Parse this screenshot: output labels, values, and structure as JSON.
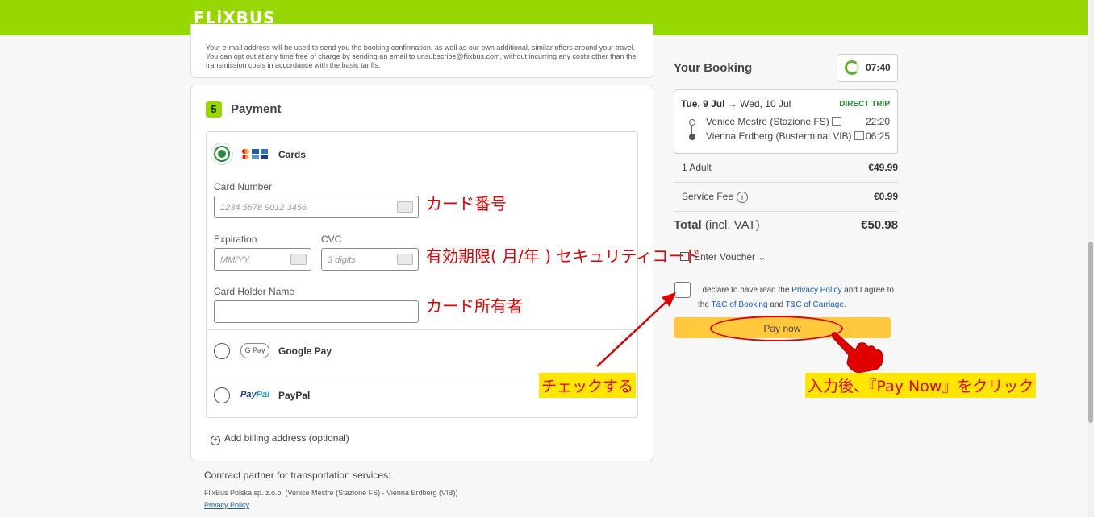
{
  "header": {
    "logo": "FLiXBUS"
  },
  "email_notice": "Your e-mail address will be used to send you the booking confirmation, as well as our own additional, similar offers around your travel. You can opt out at any time free of charge by sending an email to unsubscribe@flixbus.com, without incurring any costs other than the transmission costs in accordance with the basic tariffs.",
  "payment": {
    "step": "5",
    "title": "Payment",
    "methods": {
      "cards": {
        "label": "Cards",
        "selected": true
      },
      "google_pay": {
        "label": "Google Pay",
        "logo": "G Pay"
      },
      "paypal": {
        "label": "PayPal",
        "logo_a": "Pay",
        "logo_b": "Pal"
      }
    },
    "fields": {
      "card_number_label": "Card Number",
      "card_number_placeholder": "1234 5678 9012 3456",
      "expiration_label": "Expiration",
      "expiration_placeholder": "MM/YY",
      "cvc_label": "CVC",
      "cvc_placeholder": "3 digits",
      "holder_label": "Card Holder Name"
    },
    "billing": "Add billing address (optional)"
  },
  "footer": {
    "contract": "Contract partner for transportation services:",
    "partner": "FlixBus Polska sp. z.o.o. (Venice Mestre (Stazione FS) - Vienna Erdberg (VIB))",
    "privacy": "Privacy Policy"
  },
  "annotations": {
    "card_number": "カード番号",
    "expiry_cvc": "有効期限( 月/年 ) セキュリティコード",
    "holder": "カード所有者",
    "check": "チェックする",
    "pay_now": "入力後、『Pay Now』をクリック"
  },
  "booking": {
    "title": "Your Booking",
    "timer": "07:40",
    "date_from": "Tue, 9 Jul",
    "date_to": "Wed, 10 Jul",
    "direct": "DIRECT TRIP",
    "from_stop": "Venice Mestre (Stazione FS)",
    "from_time": "22:20",
    "to_stop": "Vienna Erdberg (Busterminal VIB)",
    "to_time": "06:25",
    "adult_label": "1 Adult",
    "adult_price": "€49.99",
    "fee_label": "Service Fee",
    "fee_price": "€0.99",
    "total_label": "Total",
    "total_note": "(incl. VAT)",
    "total_price": "€50.98",
    "voucher": "Enter Voucher",
    "declare_1": "I declare to have read the",
    "privacy_link": "Privacy Policy",
    "declare_2": "and I agree to the",
    "tc_booking": "T&C of Booking",
    "declare_3": "and",
    "tc_carriage": "T&C of Carriage",
    "pay_now": "Pay now"
  },
  "colors": {
    "brand": "#97d700",
    "accent_red": "#e00000",
    "pay_button": "#ffc83d",
    "selected": "#2a8a3a"
  }
}
